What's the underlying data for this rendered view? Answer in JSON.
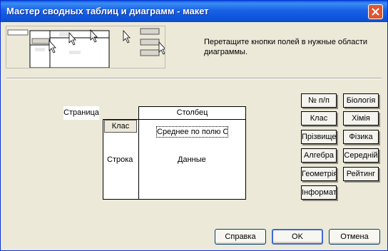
{
  "window": {
    "title": "Мастер сводных таблиц и диаграмм - макет"
  },
  "instructions": "Перетащите кнопки полей в нужные области диаграммы.",
  "layout": {
    "page_label": "Страница",
    "column_label": "Столбец",
    "row_label": "Строка",
    "data_label": "Данные",
    "row_field": "Клас",
    "data_field": "Среднее по полю С"
  },
  "fields": [
    "№ п/п",
    "Біологія",
    "Клас",
    "Хімія",
    "Прізвище",
    "Фізика",
    "Алгебра",
    "Середній",
    "Геометрія",
    "Рейтинг",
    "Інформат"
  ],
  "buttons": {
    "help": "Справка",
    "ok": "OK",
    "cancel": "Отмена"
  }
}
